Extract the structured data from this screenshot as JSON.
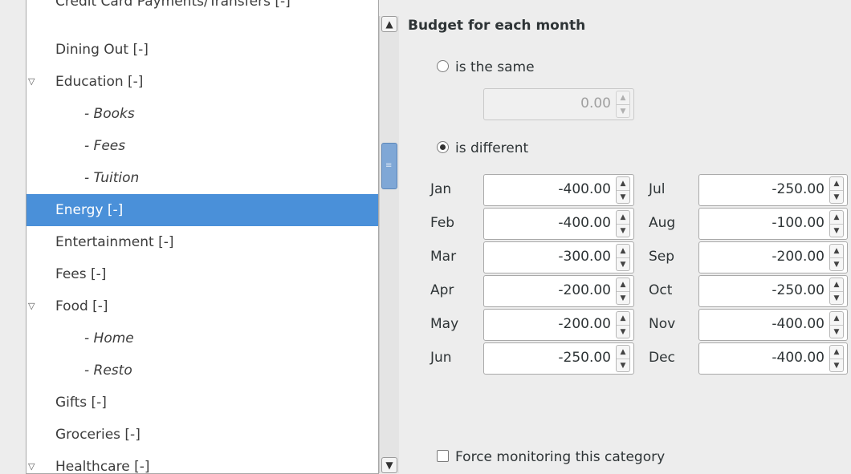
{
  "tree": {
    "items": [
      {
        "label": "Credit Card Payments/Transfers [-]",
        "level": 0,
        "expander": false,
        "selected": false,
        "clipped": true
      },
      {
        "label": "Dining Out [-]",
        "level": 0,
        "expander": false,
        "selected": false
      },
      {
        "label": "Education [-]",
        "level": 0,
        "expander": true,
        "selected": false
      },
      {
        "label": "- Books",
        "level": 1,
        "expander": false,
        "selected": false
      },
      {
        "label": "- Fees",
        "level": 1,
        "expander": false,
        "selected": false
      },
      {
        "label": "- Tuition",
        "level": 1,
        "expander": false,
        "selected": false
      },
      {
        "label": "Energy [-]",
        "level": 0,
        "expander": false,
        "selected": true
      },
      {
        "label": "Entertainment [-]",
        "level": 0,
        "expander": false,
        "selected": false
      },
      {
        "label": "Fees [-]",
        "level": 0,
        "expander": false,
        "selected": false
      },
      {
        "label": "Food [-]",
        "level": 0,
        "expander": true,
        "selected": false
      },
      {
        "label": "- Home",
        "level": 1,
        "expander": false,
        "selected": false
      },
      {
        "label": "- Resto",
        "level": 1,
        "expander": false,
        "selected": false
      },
      {
        "label": "Gifts [-]",
        "level": 0,
        "expander": false,
        "selected": false
      },
      {
        "label": "Groceries [-]",
        "level": 0,
        "expander": false,
        "selected": false
      },
      {
        "label": "Healthcare [-]",
        "level": 0,
        "expander": true,
        "selected": false,
        "clipped": true
      }
    ]
  },
  "icons": {
    "expander": "triangle-down-icon",
    "scroll_up": "chevron-up-icon",
    "scroll_down": "chevron-down-icon",
    "spin_up": "spin-up-icon",
    "spin_down": "spin-down-icon"
  },
  "colors": {
    "selection": "#4a90d9",
    "scroll_thumb": "#7fa7d6",
    "background": "#ededed"
  },
  "budget": {
    "title": "Budget for each month",
    "same_label": "is the same",
    "same_value": "0.00",
    "different_label": "is different",
    "mode": "different",
    "months": [
      {
        "name": "Jan",
        "value": "-400.00"
      },
      {
        "name": "Feb",
        "value": "-400.00"
      },
      {
        "name": "Mar",
        "value": "-300.00"
      },
      {
        "name": "Apr",
        "value": "-200.00"
      },
      {
        "name": "May",
        "value": "-200.00"
      },
      {
        "name": "Jun",
        "value": "-250.00"
      },
      {
        "name": "Jul",
        "value": "-250.00"
      },
      {
        "name": "Aug",
        "value": "-100.00"
      },
      {
        "name": "Sep",
        "value": "-200.00"
      },
      {
        "name": "Oct",
        "value": "-250.00"
      },
      {
        "name": "Nov",
        "value": "-400.00"
      },
      {
        "name": "Dec",
        "value": "-400.00"
      }
    ],
    "force_monitoring_label": "Force monitoring this category",
    "force_monitoring_checked": false
  }
}
